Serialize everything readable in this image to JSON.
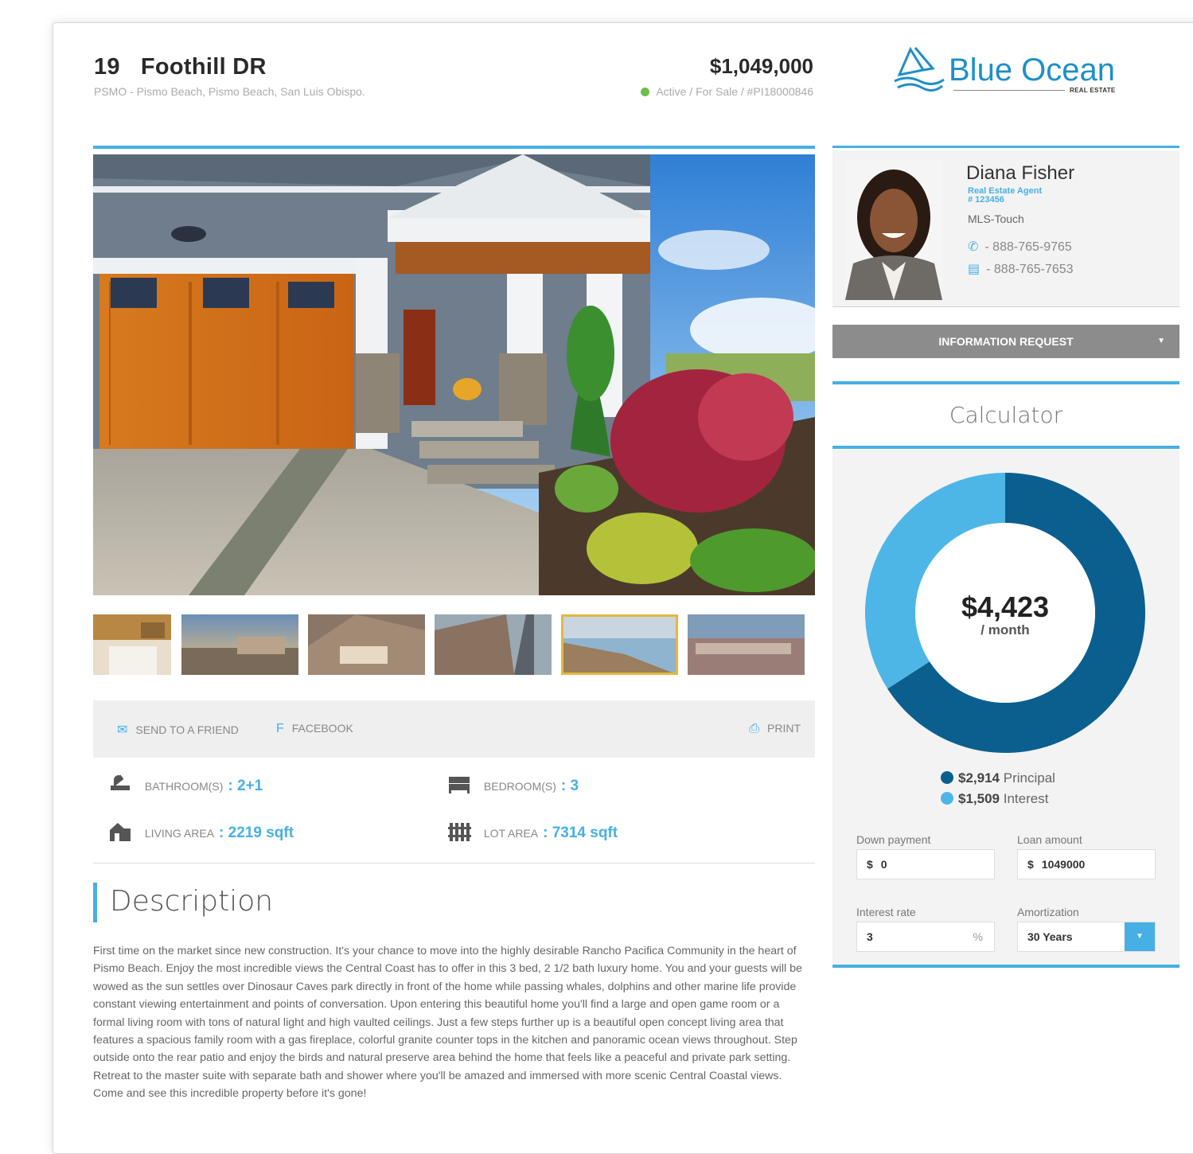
{
  "listing": {
    "street_number": "19",
    "street_name": "Foothill DR",
    "subaddress": "PSMO - Pismo Beach, Pismo Beach, San Luis Obispo.",
    "price": "$1,049,000",
    "status": "Active / For Sale / #PI18000846",
    "status_color": "#6cc04a"
  },
  "brand": {
    "name": "Blue Ocean",
    "tagline": "REAL ESTATE",
    "color": "#1e8fc8"
  },
  "gallery": {
    "thumbnails": [
      "thumb-kitchen",
      "thumb-deck-sunset",
      "thumb-hillside-homes",
      "thumb-coast-road",
      "thumb-ocean-bluff",
      "thumb-coastal-town"
    ],
    "selected_index": 4
  },
  "share": {
    "send_label": "SEND TO A FRIEND",
    "facebook_label": "FACEBOOK",
    "print_label": "PRINT"
  },
  "features": {
    "bathrooms_label": "BATHROOM(S)",
    "bathrooms_value": ": 2+1",
    "bedrooms_label": "BEDROOM(S)",
    "bedrooms_value": ": 3",
    "living_label": "LIVING AREA",
    "living_value": ": 2219 sqft",
    "lot_label": "LOT AREA",
    "lot_value": ": 7314 sqft"
  },
  "description": {
    "title": "Description",
    "body": "First time on the market since new construction. It's your chance to move into the highly desirable Rancho Pacifica Community in the heart of Pismo Beach. Enjoy the most incredible views the Central Coast has to offer in this 3 bed, 2 1/2 bath luxury home. You and your guests will be wowed as the sun settles over Dinosaur Caves park directly in front of the home while passing whales, dolphins and other marine life provide constant viewing entertainment and points of conversation. Upon entering this beautiful home you'll find a large and open game room or a formal living room with tons of natural light and high vaulted ceilings. Just a few steps further up is a beautiful open concept living area that features a spacious family room with a gas fireplace, colorful granite counter tops in the kitchen and panoramic ocean views throughout. Step outside onto the rear patio and enjoy the birds and natural preserve area behind the home that feels like a peaceful and private park setting. Retreat to the master suite with separate bath and shower where you'll be amazed and immersed with more scenic Central Coastal views. Come and see this incredible property before it's gone!"
  },
  "agent": {
    "name": "Diana Fisher",
    "role": "Real Estate Agent",
    "license": "# 123456",
    "mls": "MLS-Touch",
    "phone": "- 888-765-9765",
    "fax": "- 888-765-7653"
  },
  "info_request": {
    "label": "INFORMATION REQUEST"
  },
  "calculator": {
    "title": "Calculator",
    "monthly": "$4,423",
    "per": "/ month",
    "principal_amount": "$2,914",
    "principal_label": "Principal",
    "interest_amount": "$1,509",
    "interest_label": "Interest",
    "principal_value": 2914,
    "interest_value": 1509,
    "principal_color": "#0b5f8f",
    "interest_color": "#4eb6e6",
    "down_payment_label": "Down payment",
    "down_payment_currency": "$",
    "down_payment_value": "0",
    "loan_amount_label": "Loan amount",
    "loan_amount_currency": "$",
    "loan_amount_value": "1049000",
    "interest_rate_label": "Interest rate",
    "interest_rate_value": "3",
    "interest_rate_unit": "%",
    "amortization_label": "Amortization",
    "amortization_value": "30 Years"
  }
}
